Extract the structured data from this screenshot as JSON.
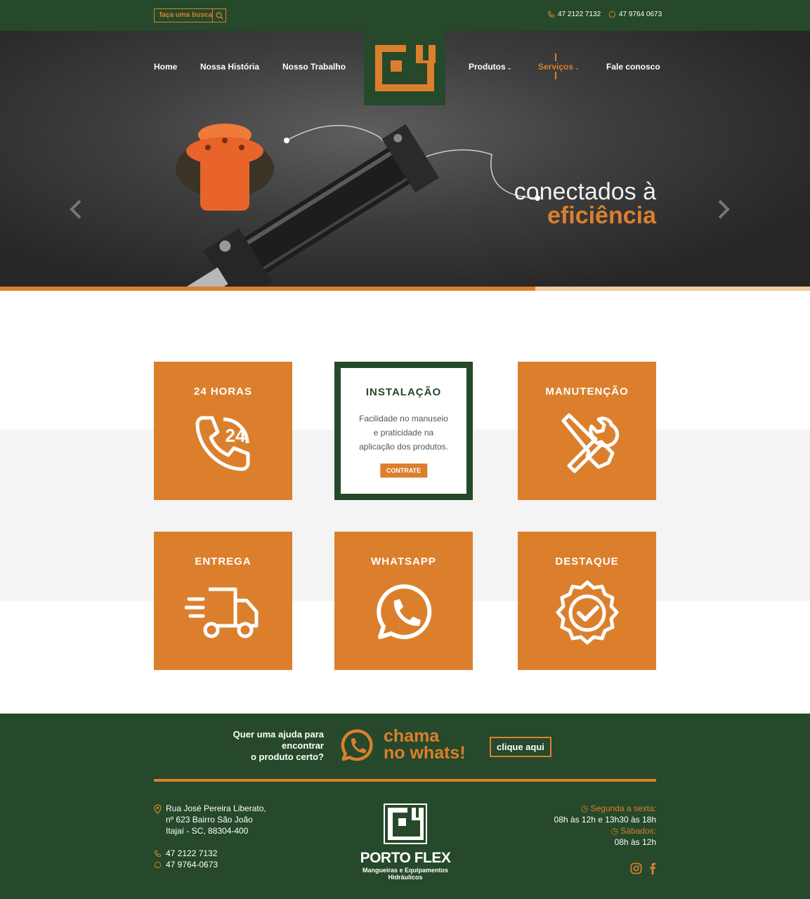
{
  "colors": {
    "green": "#25492a",
    "orange": "#dc7f2d",
    "light_orange": "#f3c9a0"
  },
  "top": {
    "search_placeholder": "faça uma busca",
    "phone": "47 2122 7132",
    "whatsapp": "47 9764 0673"
  },
  "nav": {
    "home": "Home",
    "historia": "Nossa História",
    "trabalho": "Nosso Trabalho",
    "produtos": "Produtos",
    "servicos": "Serviços",
    "contato": "Fale conosco"
  },
  "hero": {
    "line1": "conectados à",
    "line2": "eficiência"
  },
  "cards": {
    "c1": {
      "title": "24 HORAS",
      "icon": "phone-24-icon"
    },
    "c2": {
      "title": "INSTALAÇÃO",
      "desc_1": "Facilidade no manuseio",
      "desc_2": "e praticidade na",
      "desc_3": "aplicação dos produtos.",
      "button": "CONTRATE"
    },
    "c3": {
      "title": "MANUTENÇÃO",
      "icon": "tools-icon"
    },
    "c4": {
      "title": "ENTREGA",
      "icon": "truck-icon"
    },
    "c5": {
      "title": "WHATSAPP",
      "icon": "whatsapp-icon"
    },
    "c6": {
      "title": "DESTAQUE",
      "icon": "badge-check-icon"
    }
  },
  "footer": {
    "cta_1": "Quer uma ajuda para",
    "cta_2": "encontrar",
    "cta_3": "o produto certo?",
    "big_1": "chama",
    "big_2": "no whats!",
    "cta_button": "clique aqui",
    "addr_1": "Rua José Pereira Liberato,",
    "addr_2": "nº 623 Bairro São João",
    "addr_3": "Itajaí - SC, 88304-400",
    "phone": "47 2122 7132",
    "whatsapp": "47 9764-0673",
    "brand": "PORTO FLEX",
    "tagline_1": "Mangueiras e Equipamentos",
    "tagline_2": "Hidráulicos",
    "hours_label_1": "Segunda a sexta:",
    "hours_value_1": "08h às 12h e 13h30 às 18h",
    "hours_label_2": "Sábados:",
    "hours_value_2": "08h às 12h"
  }
}
